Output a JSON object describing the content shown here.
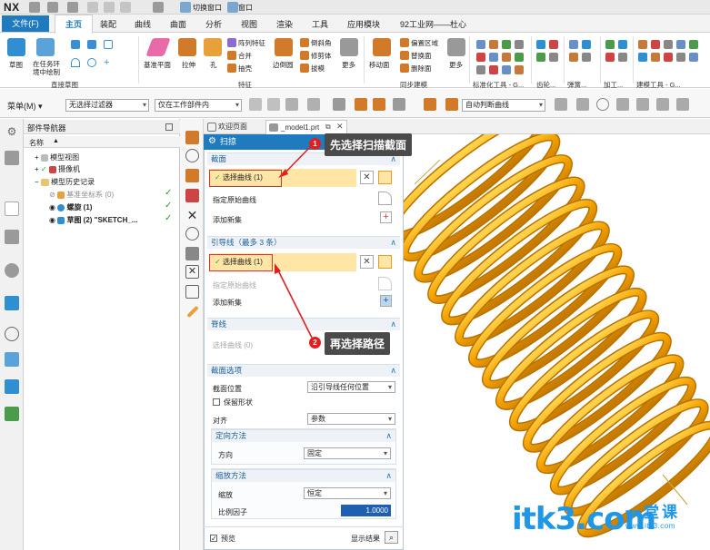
{
  "titlebar": {
    "logo": "NX",
    "switch_window_label": "切换窗口",
    "window_label": "窗口"
  },
  "menu": {
    "file": "文件(F)",
    "tabs": [
      "主页",
      "装配",
      "曲线",
      "曲面",
      "分析",
      "视图",
      "渲染",
      "工具",
      "应用模块",
      "92工业网——杜心"
    ]
  },
  "ribbon": {
    "groups": [
      "直接草图",
      "特征",
      "同步建模",
      "标准化工具 - G...",
      "齿轮...",
      "弹簧...",
      "加工...",
      "建模工具 - G..."
    ],
    "big_buttons": [
      {
        "label": "草图",
        "icon": "sketch-icon",
        "color": "#2f8fd1"
      },
      {
        "label": "在任务环境中绘制",
        "icon": "task-sketch-icon",
        "color": "#2f8fd1"
      },
      {
        "label": "基准平面",
        "icon": "datum-plane-icon",
        "color": "#e86aa8"
      },
      {
        "label": "拉伸",
        "icon": "extrude-icon",
        "color": "#d07a2a"
      },
      {
        "label": "孔",
        "icon": "hole-icon",
        "color": "#e8a13a"
      },
      {
        "label": "边倒圆",
        "icon": "edge-blend-icon",
        "color": "#d07a2a"
      },
      {
        "label": "更多",
        "icon": "more-icon",
        "color": "#777777"
      },
      {
        "label": "移动面",
        "icon": "move-face-icon",
        "color": "#d07a2a"
      },
      {
        "label": "更多",
        "icon": "more-icon",
        "color": "#777777"
      }
    ],
    "small_buttons": [
      "阵列特征",
      "合并",
      "抽壳",
      "倒斜角",
      "修剪体",
      "拔模",
      "偏置区域",
      "替换面",
      "删除面"
    ]
  },
  "toolbar": {
    "menu_label": "菜单(M)",
    "filter_select": "无选择过滤器",
    "scope_select": "仅在工作部件内",
    "snap_select": "自动判断曲线"
  },
  "navigator": {
    "title": "部件导航器",
    "col_name": "名称",
    "rows": [
      "模型视图",
      "摄像机",
      "模型历史记录",
      "基准坐标系 (0)",
      "螺旋 (1)",
      "草图 (2) \"SKETCH_..."
    ]
  },
  "doc_tabs": [
    "欢迎页面",
    "_model1.prt"
  ],
  "dialog": {
    "title": "扫掠",
    "section": {
      "title": "截面",
      "select_curve": "选择曲线 (1)",
      "specify_origin": "指定原始曲线",
      "add_new": "添加新集"
    },
    "guide": {
      "title": "引导线（最多 3 条）",
      "select_curve": "选择曲线 (1)",
      "specify_origin": "指定原始曲线",
      "add_new": "添加新集"
    },
    "spine": {
      "title": "脊线",
      "select_curve": "选择曲线 (0)"
    },
    "options": {
      "title": "截面选项",
      "position_label": "截面位置",
      "position_value": "沿引导线任何位置",
      "keep_shape": "保留形状",
      "align_label": "对齐",
      "align_value": "参数",
      "orient_title": "定向方法",
      "dir_label": "方向",
      "dir_value": "固定",
      "scale_title": "缩放方法",
      "scale_label": "缩放",
      "scale_value": "恒定",
      "ratio_label": "比例因子",
      "ratio_value": "1.0000"
    },
    "preview": "预览",
    "show_result": "显示结果"
  },
  "annotations": {
    "step1_num": "1",
    "step1_text": "先选择扫描截面",
    "step2_num": "2",
    "step2_text": "再选择路径"
  },
  "watermark": {
    "brand": "itk3.com",
    "cn": "一堂课",
    "url": "www.itk3.com"
  },
  "colors": {
    "accent": "#1f7bbd",
    "spring": "#f0a000",
    "highlight": "#ffe6a6",
    "annotation_red": "#e02020"
  }
}
